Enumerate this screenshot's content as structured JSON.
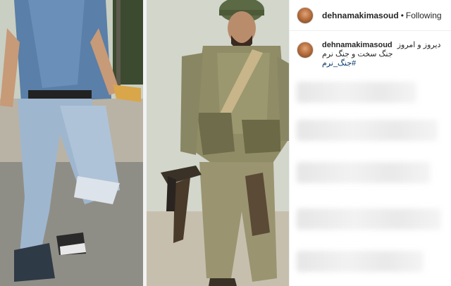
{
  "post": {
    "username": "dehnamakimasoud",
    "separator": "•",
    "follow_status": "Following"
  },
  "caption": {
    "username": "dehnamakimasoud",
    "line1": "دیروز و امروز",
    "line2": "جنگ سخت و جنگ نرم",
    "hashtag": "#جنگ_نرم"
  },
  "colors": {
    "link": "#003569",
    "text": "#262626",
    "border": "#efefef"
  }
}
